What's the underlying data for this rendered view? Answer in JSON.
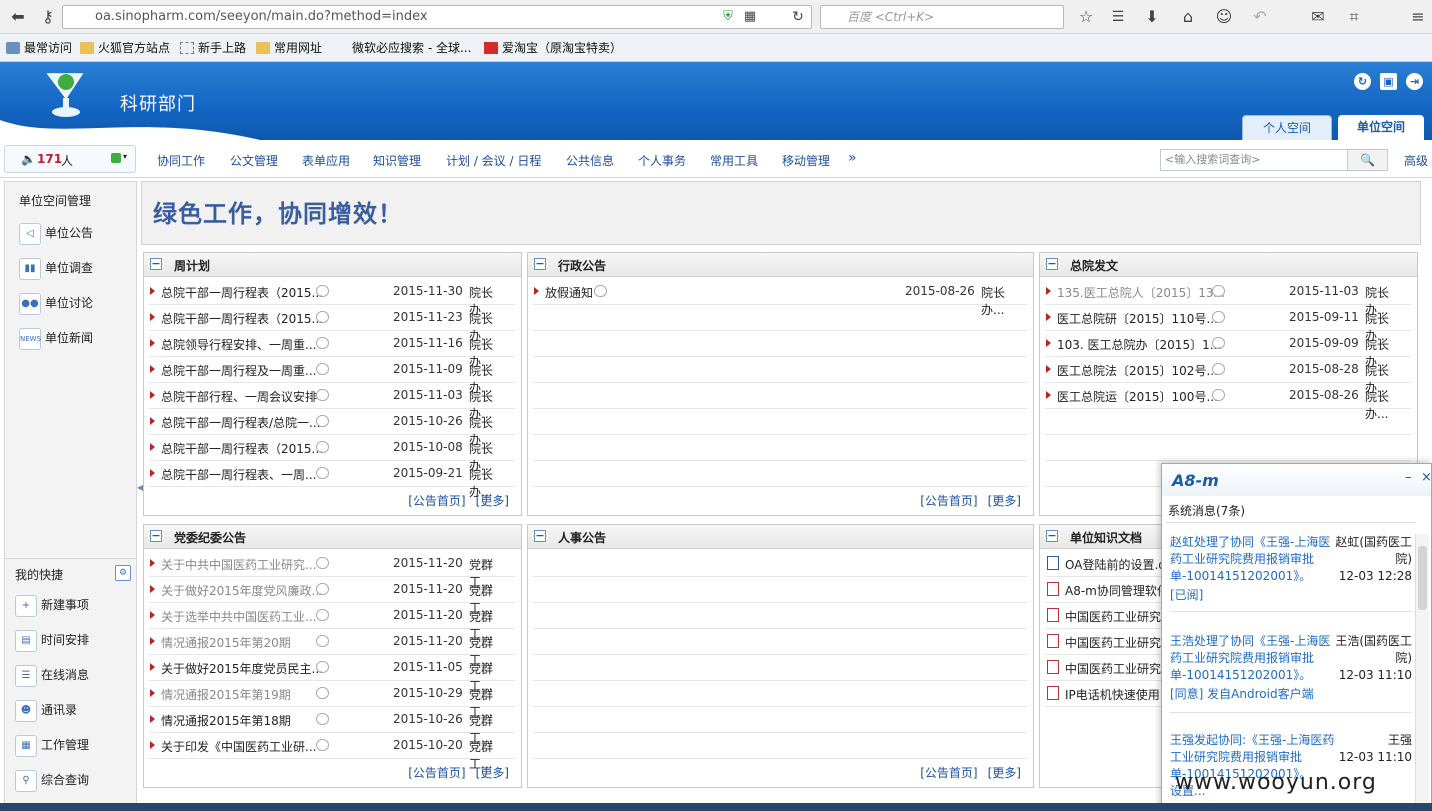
{
  "browser": {
    "url": "oa.sinopharm.com/seeyon/main.do?method=index",
    "search_placeholder": "百度 <Ctrl+K>",
    "bookmarks": [
      "最常访问",
      "火狐官方站点",
      "新手上路",
      "常用网址",
      "微软必应搜索 - 全球...",
      "爱淘宝（原淘宝特卖）"
    ]
  },
  "header": {
    "dept_name": "科研部门",
    "tabs": [
      "个人空间",
      "单位空间"
    ]
  },
  "nav": {
    "online_count": "171",
    "online_unit": "人",
    "items": [
      "协同工作",
      "公文管理",
      "表单应用",
      "知识管理",
      "计划 / 会议 / 日程",
      "公共信息",
      "个人事务",
      "常用工具",
      "移动管理"
    ],
    "more": "»",
    "search_placeholder": "<输入搜索词查询>",
    "advanced": "高级"
  },
  "sidebar": {
    "title": "单位空间管理",
    "items": [
      "单位公告",
      "单位调查",
      "单位讨论",
      "单位新闻"
    ],
    "shortcuts_title": "我的快捷",
    "shortcuts": [
      "新建事项",
      "时间安排",
      "在线消息",
      "通讯录",
      "工作管理",
      "综合查询"
    ]
  },
  "slogan": "绿色工作，协同增效！",
  "panels": {
    "weekly": {
      "title": "周计划",
      "rows": [
        {
          "title": "总院干部一周行程表（2015...",
          "date": "2015-11-30",
          "author": "院长办..."
        },
        {
          "title": "总院干部一周行程表（2015...",
          "date": "2015-11-23",
          "author": "院长办..."
        },
        {
          "title": "总院领导行程安排、一周重...",
          "date": "2015-11-16",
          "author": "院长办..."
        },
        {
          "title": "总院干部一周行程及一周重...",
          "date": "2015-11-09",
          "author": "院长办..."
        },
        {
          "title": "总院干部行程、一周会议安排",
          "date": "2015-11-03",
          "author": "院长办..."
        },
        {
          "title": "总院干部一周行程表/总院一...",
          "date": "2015-10-26",
          "author": "院长办..."
        },
        {
          "title": "总院干部一周行程表（2015...",
          "date": "2015-10-08",
          "author": "院长办..."
        },
        {
          "title": "总院干部一周行程表、一周...",
          "date": "2015-09-21",
          "author": "院长办..."
        }
      ],
      "footer": [
        "[公告首页]",
        "[更多]"
      ]
    },
    "admin": {
      "title": "行政公告",
      "rows": [
        {
          "title": "放假通知",
          "date": "2015-08-26",
          "author": "院长办..."
        }
      ],
      "footer": [
        "[公告首页]",
        "[更多]"
      ]
    },
    "docs": {
      "title": "总院发文",
      "rows": [
        {
          "title": "135.医工总院人〔2015〕13...",
          "date": "2015-11-03",
          "author": "院长办..."
        },
        {
          "title": "医工总院研〔2015〕110号...",
          "date": "2015-09-11",
          "author": "院长办..."
        },
        {
          "title": "103. 医工总院办〔2015〕1...",
          "date": "2015-09-09",
          "author": "院长办..."
        },
        {
          "title": "医工总院法〔2015〕102号...",
          "date": "2015-08-28",
          "author": "院长办..."
        },
        {
          "title": "医工总院运〔2015〕100号...",
          "date": "2015-08-26",
          "author": "院长办..."
        }
      ]
    },
    "party": {
      "title": "党委纪委公告",
      "rows": [
        {
          "title": "关于中共中国医药工业研究...",
          "date": "2015-11-20",
          "author": "党群工..."
        },
        {
          "title": "关于做好2015年度党风廉政...",
          "date": "2015-11-20",
          "author": "党群工..."
        },
        {
          "title": "关于选举中共中国医药工业...",
          "date": "2015-11-20",
          "author": "党群工..."
        },
        {
          "title": "情况通报2015年第20期",
          "date": "2015-11-20",
          "author": "党群工..."
        },
        {
          "title": "关于做好2015年度党员民主...",
          "date": "2015-11-05",
          "author": "党群工..."
        },
        {
          "title": "情况通报2015年第19期",
          "date": "2015-10-29",
          "author": "党群工..."
        },
        {
          "title": "情况通报2015年第18期",
          "date": "2015-10-26",
          "author": "党群工..."
        },
        {
          "title": "关于印发《中国医药工业研...",
          "date": "2015-10-20",
          "author": "党群工..."
        }
      ],
      "footer": [
        "[公告首页]",
        "[更多]"
      ]
    },
    "hr": {
      "title": "人事公告",
      "footer": [
        "[公告首页]",
        "[更多]"
      ]
    },
    "knowledge": {
      "title": "单位知识文档",
      "rows": [
        {
          "title": "OA登陆前的设置.d"
        },
        {
          "title": "A8-m协同管理软件"
        },
        {
          "title": "中国医药工业研究"
        },
        {
          "title": "中国医药工业研究"
        },
        {
          "title": "中国医药工业研究"
        },
        {
          "title": "IP电话机快速使用"
        }
      ]
    }
  },
  "popup": {
    "brand": "A8-m",
    "minimize": "–",
    "close": "×",
    "header": "系统消息(7条)",
    "messages": [
      {
        "text": "赵虹处理了协同《王强-上海医药工业研究院费用报销审批单-10014151202001》。",
        "status": "[已阅]",
        "from": "赵虹(国药医工院)",
        "time": "12-03 12:28"
      },
      {
        "text": "王浩处理了协同《王强-上海医药工业研究院费用报销审批单-10014151202001》。",
        "status": "[同意] 发自Android客户端",
        "from": "王浩(国药医工院)",
        "time": "12-03 11:10"
      },
      {
        "text": "王强发起协同:《王强-上海医药工业研究院费用报销审批单-10014151202001》。",
        "status": "",
        "from": "王强",
        "time": "12-03 11:10"
      }
    ],
    "settings": "设置..."
  },
  "watermark": "www.wooyun.org"
}
